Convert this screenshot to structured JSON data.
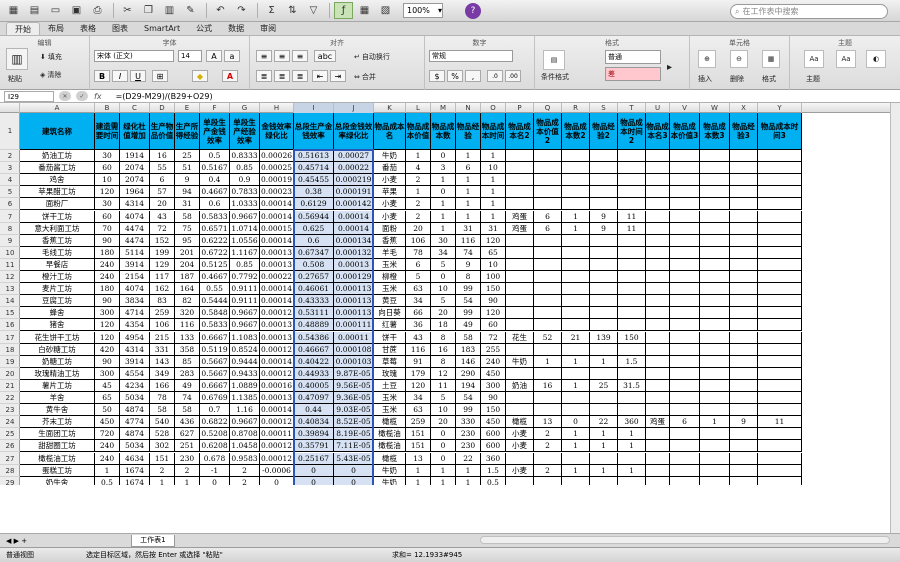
{
  "toolbar": {
    "zoom": "100%",
    "search_placeholder": "在工作表中搜索"
  },
  "tabs": [
    "开始",
    "布局",
    "表格",
    "图表",
    "SmartArt",
    "公式",
    "数据",
    "审阅"
  ],
  "ribbon": {
    "groups": [
      "编辑",
      "字体",
      "对齐",
      "数字",
      "格式",
      "单元格",
      "主题"
    ],
    "paste": "粘贴",
    "fill": "填充",
    "clear": "清除",
    "font_name": "宋体 (正文)",
    "font_size": "14",
    "wrap": "自动换行",
    "merge": "合并",
    "number_format": "常规",
    "cond_format": "条件格式",
    "style_normal": "普通",
    "style_bad": "差",
    "insert": "插入",
    "delete": "删除",
    "format": "格式",
    "theme": "主题"
  },
  "formula_bar": {
    "name_box": "I29",
    "formula": "=(D29-M29)/(B29+O29)",
    "fx": "fx"
  },
  "columns": [
    "A",
    "B",
    "C",
    "D",
    "E",
    "F",
    "G",
    "H",
    "I",
    "J",
    "K",
    "L",
    "M",
    "N",
    "O",
    "P",
    "Q",
    "R",
    "S",
    "T",
    "U",
    "V",
    "W",
    "X",
    "Y"
  ],
  "headers": [
    "建筑名称",
    "建造需要时间",
    "绿化杜值增加",
    "生产物品价值",
    "生产所得经验",
    "单段生产金钱效率",
    "单段生产经验效率",
    "金钱效率绿化比",
    "总段生产金钱效率",
    "总段金钱效率绿化比",
    "物品成本名",
    "物品成本价值",
    "物品成本数",
    "物品经验",
    "物品成本时间",
    "物品成本名2",
    "物品成本价值2",
    "物品成本数2",
    "物品经验2",
    "物品成本时间2",
    "物品成本名3",
    "物品成本价值3",
    "物品成本数3",
    "物品经验3",
    "物品成本时间3"
  ],
  "rows": [
    [
      "奶油工坊",
      "30",
      "1914",
      "16",
      "25",
      "0.5",
      "0.8333",
      "0.00026",
      "0.51613",
      "0.00027",
      "牛奶",
      "1",
      "0",
      "1",
      "1",
      "",
      "",
      "",
      "",
      "",
      "",
      "",
      "",
      "",
      ""
    ],
    [
      "番茄酱工坊",
      "60",
      "2074",
      "55",
      "51",
      "0.5167",
      "0.85",
      "0.00025",
      "0.45714",
      "0.00022",
      "番茄",
      "4",
      "3",
      "6",
      "10",
      "",
      "",
      "",
      "",
      "",
      "",
      "",
      "",
      "",
      ""
    ],
    [
      "鸡舍",
      "10",
      "2074",
      "6",
      "9",
      "0.4",
      "0.9",
      "0.00019",
      "0.45455",
      "0.000219",
      "小麦",
      "2",
      "1",
      "1",
      "1",
      "",
      "",
      "",
      "",
      "",
      "",
      "",
      "",
      "",
      ""
    ],
    [
      "苹果醋工坊",
      "120",
      "1964",
      "57",
      "94",
      "0.4667",
      "0.7833",
      "0.00023",
      "0.38",
      "0.000191",
      "苹果",
      "1",
      "0",
      "1",
      "1",
      "",
      "",
      "",
      "",
      "",
      "",
      "",
      "",
      "",
      ""
    ],
    [
      "面粉厂",
      "30",
      "4314",
      "20",
      "31",
      "0.6",
      "1.0333",
      "0.00014",
      "0.6129",
      "0.000142",
      "小麦",
      "2",
      "1",
      "1",
      "1",
      "",
      "",
      "",
      "",
      "",
      "",
      "",
      "",
      "",
      ""
    ],
    [
      "饼干工坊",
      "60",
      "4074",
      "43",
      "58",
      "0.5833",
      "0.9667",
      "0.00014",
      "0.56944",
      "0.00014",
      "小麦",
      "2",
      "1",
      "1",
      "1",
      "鸡蛋",
      "6",
      "1",
      "9",
      "11",
      "",
      "",
      "",
      "",
      ""
    ],
    [
      "意大利面工坊",
      "70",
      "4474",
      "72",
      "75",
      "0.6571",
      "1.0714",
      "0.00015",
      "0.625",
      "0.00014",
      "面粉",
      "20",
      "1",
      "31",
      "31",
      "鸡蛋",
      "6",
      "1",
      "9",
      "11",
      "",
      "",
      "",
      "",
      ""
    ],
    [
      "香蕉工坊",
      "90",
      "4474",
      "152",
      "95",
      "0.6222",
      "1.0556",
      "0.00014",
      "0.6",
      "0.000134",
      "香蕉",
      "106",
      "30",
      "116",
      "120",
      "",
      "",
      "",
      "",
      "",
      "",
      "",
      "",
      "",
      ""
    ],
    [
      "毛线工坊",
      "180",
      "5114",
      "199",
      "201",
      "0.6722",
      "1.1167",
      "0.00013",
      "0.67347",
      "0.000132",
      "羊毛",
      "78",
      "34",
      "74",
      "65",
      "",
      "",
      "",
      "",
      "",
      "",
      "",
      "",
      "",
      ""
    ],
    [
      "早餐店",
      "240",
      "3914",
      "129",
      "204",
      "0.5125",
      "0.85",
      "0.00013",
      "0.508",
      "0.00013",
      "玉米",
      "6",
      "5",
      "9",
      "10",
      "",
      "",
      "",
      "",
      "",
      "",
      "",
      "",
      "",
      ""
    ],
    [
      "橙汁工坊",
      "240",
      "2154",
      "117",
      "187",
      "0.4667",
      "0.7792",
      "0.00022",
      "0.27657",
      "0.000129",
      "柳橙",
      "5",
      "0",
      "8",
      "100",
      "",
      "",
      "",
      "",
      "",
      "",
      "",
      "",
      "",
      ""
    ],
    [
      "麦片工坊",
      "180",
      "4074",
      "162",
      "164",
      "0.55",
      "0.9111",
      "0.00014",
      "0.46061",
      "0.000113",
      "玉米",
      "63",
      "10",
      "99",
      "150",
      "",
      "",
      "",
      "",
      "",
      "",
      "",
      "",
      "",
      ""
    ],
    [
      "豆腐工坊",
      "90",
      "3834",
      "83",
      "82",
      "0.5444",
      "0.9111",
      "0.00014",
      "0.43333",
      "0.000113",
      "黄豆",
      "34",
      "5",
      "54",
      "90",
      "",
      "",
      "",
      "",
      "",
      "",
      "",
      "",
      "",
      ""
    ],
    [
      "蜂舍",
      "300",
      "4714",
      "259",
      "320",
      "0.5848",
      "0.9667",
      "0.00012",
      "0.53111",
      "0.000113",
      "向日葵",
      "66",
      "20",
      "99",
      "120",
      "",
      "",
      "",
      "",
      "",
      "",
      "",
      "",
      "",
      ""
    ],
    [
      "猪舍",
      "120",
      "4354",
      "106",
      "116",
      "0.5833",
      "0.9667",
      "0.00013",
      "0.48889",
      "0.000111",
      "红薯",
      "36",
      "18",
      "49",
      "60",
      "",
      "",
      "",
      "",
      "",
      "",
      "",
      "",
      "",
      ""
    ],
    [
      "花生饼干工坊",
      "120",
      "4954",
      "215",
      "133",
      "0.6667",
      "1.1083",
      "0.00013",
      "0.54386",
      "0.00011",
      "饼干",
      "43",
      "8",
      "58",
      "72",
      "花生",
      "52",
      "21",
      "139",
      "150",
      "",
      "",
      "",
      "",
      ""
    ],
    [
      "白砂糖工坊",
      "420",
      "4314",
      "331",
      "358",
      "0.5119",
      "0.8524",
      "0.00012",
      "0.46667",
      "0.000108",
      "甘蔗",
      "116",
      "16",
      "183",
      "255",
      "",
      "",
      "",
      "",
      "",
      "",
      "",
      "",
      "",
      ""
    ],
    [
      "奶糖工坊",
      "90",
      "3914",
      "143",
      "85",
      "0.5667",
      "0.9444",
      "0.00014",
      "0.40422",
      "0.000103",
      "草莓",
      "91",
      "8",
      "146",
      "240",
      "牛奶",
      "1",
      "1",
      "1",
      "1.5",
      "",
      "",
      "",
      "",
      ""
    ],
    [
      "玫瑰精油工坊",
      "300",
      "4554",
      "349",
      "283",
      "0.5667",
      "0.9433",
      "0.00012",
      "0.44933",
      "9.87E-05",
      "玫瑰",
      "179",
      "12",
      "290",
      "450",
      "",
      "",
      "",
      "",
      "",
      "",
      "",
      "",
      "",
      ""
    ],
    [
      "薯片工坊",
      "45",
      "4234",
      "166",
      "49",
      "0.6667",
      "1.0889",
      "0.00016",
      "0.40005",
      "9.56E-05",
      "土豆",
      "120",
      "11",
      "194",
      "300",
      "奶油",
      "16",
      "1",
      "25",
      "31.5",
      "",
      "",
      "",
      "",
      ""
    ],
    [
      "羊舍",
      "65",
      "5034",
      "78",
      "74",
      "0.6769",
      "1.1385",
      "0.00013",
      "0.47097",
      "9.36E-05",
      "玉米",
      "34",
      "5",
      "54",
      "90",
      "",
      "",
      "",
      "",
      "",
      "",
      "",
      "",
      "",
      ""
    ],
    [
      "黄牛舍",
      "50",
      "4874",
      "58",
      "58",
      "0.7",
      "1.16",
      "0.00014",
      "0.44",
      "9.03E-05",
      "玉米",
      "63",
      "10",
      "99",
      "150",
      "",
      "",
      "",
      "",
      "",
      "",
      "",
      "",
      "",
      ""
    ],
    [
      "芥末工坊",
      "450",
      "4774",
      "540",
      "436",
      "0.6822",
      "0.9667",
      "0.00012",
      "0.40834",
      "8.52E-05",
      "橄榄",
      "259",
      "20",
      "330",
      "450",
      "橄榄",
      "13",
      "0",
      "22",
      "360",
      "鸡蛋",
      "6",
      "1",
      "9",
      "11"
    ],
    [
      "生面团工坊",
      "720",
      "4874",
      "528",
      "627",
      "0.5208",
      "0.8708",
      "0.00011",
      "0.39894",
      "8.19E-05",
      "橄榄油",
      "151",
      "0",
      "230",
      "600",
      "小麦",
      "2",
      "1",
      "1",
      "1",
      "",
      "",
      "",
      "",
      ""
    ],
    [
      "甜甜圈工坊",
      "240",
      "5034",
      "302",
      "251",
      "0.6208",
      "1.0458",
      "0.00012",
      "0.35791",
      "7.11E-05",
      "橄榄油",
      "151",
      "0",
      "230",
      "600",
      "小麦",
      "2",
      "1",
      "1",
      "1",
      "",
      "",
      "",
      "",
      ""
    ],
    [
      "橄榄油工坊",
      "240",
      "4634",
      "151",
      "230",
      "0.678",
      "0.9583",
      "0.00012",
      "0.25167",
      "5.43E-05",
      "橄榄",
      "13",
      "0",
      "22",
      "360",
      "",
      "",
      "",
      "",
      "",
      "",
      "",
      "",
      "",
      ""
    ],
    [
      "蛋糕工坊",
      "1",
      "1674",
      "2",
      "2",
      "-1",
      "2",
      "-0.0006",
      "0",
      "0",
      "牛奶",
      "1",
      "1",
      "1",
      "1.5",
      "小麦",
      "2",
      "1",
      "1",
      "1",
      "",
      "",
      "",
      "",
      ""
    ],
    [
      "奶牛舍",
      "0.5",
      "1674",
      "1",
      "1",
      "0",
      "2",
      "0",
      "0",
      "0",
      "牛奶",
      "1",
      "1",
      "1",
      "0.5",
      "",
      "",
      "",
      "",
      "",
      "",
      "",
      "",
      "",
      ""
    ]
  ],
  "sheet_tab": "工作表1",
  "status": {
    "mode": "普通视图",
    "hint": "选定目标区域，然后按 Enter 或选择 \"粘贴\"",
    "sum": "求和= 12.1933#945"
  }
}
